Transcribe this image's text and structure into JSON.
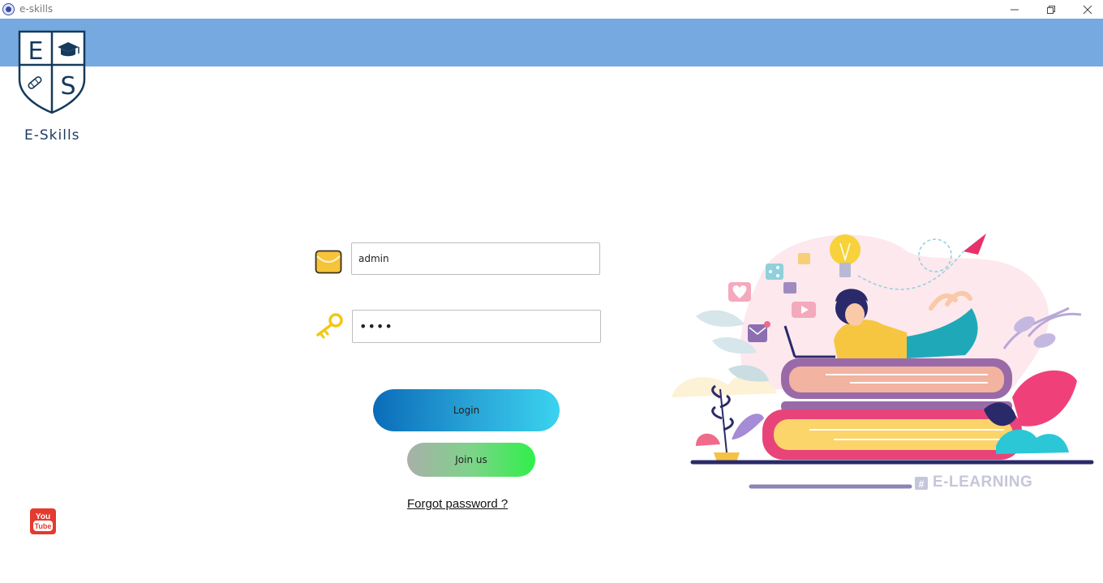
{
  "window": {
    "title": "e-skills",
    "controls": [
      "minimize",
      "restore",
      "close"
    ]
  },
  "brand": {
    "name": "E-Skills",
    "logo_letters": [
      "E",
      "S"
    ],
    "header_color": "#76a9e0"
  },
  "form": {
    "email": {
      "value": "admin",
      "icon": "envelope-icon"
    },
    "password": {
      "value": "••••",
      "icon": "key-icon"
    },
    "login_label": "Login",
    "join_label": "Join us",
    "forgot_label": "Forgot password ?"
  },
  "social": {
    "youtube_you": "You",
    "youtube_tube": "Tube"
  },
  "illustration": {
    "tag_label": "E-LEARNING",
    "hash_symbol": "#"
  },
  "colors": {
    "accent_blue": "#0a6cb9",
    "accent_cyan": "#3ad3ef",
    "join_green": "#2ff04a"
  }
}
